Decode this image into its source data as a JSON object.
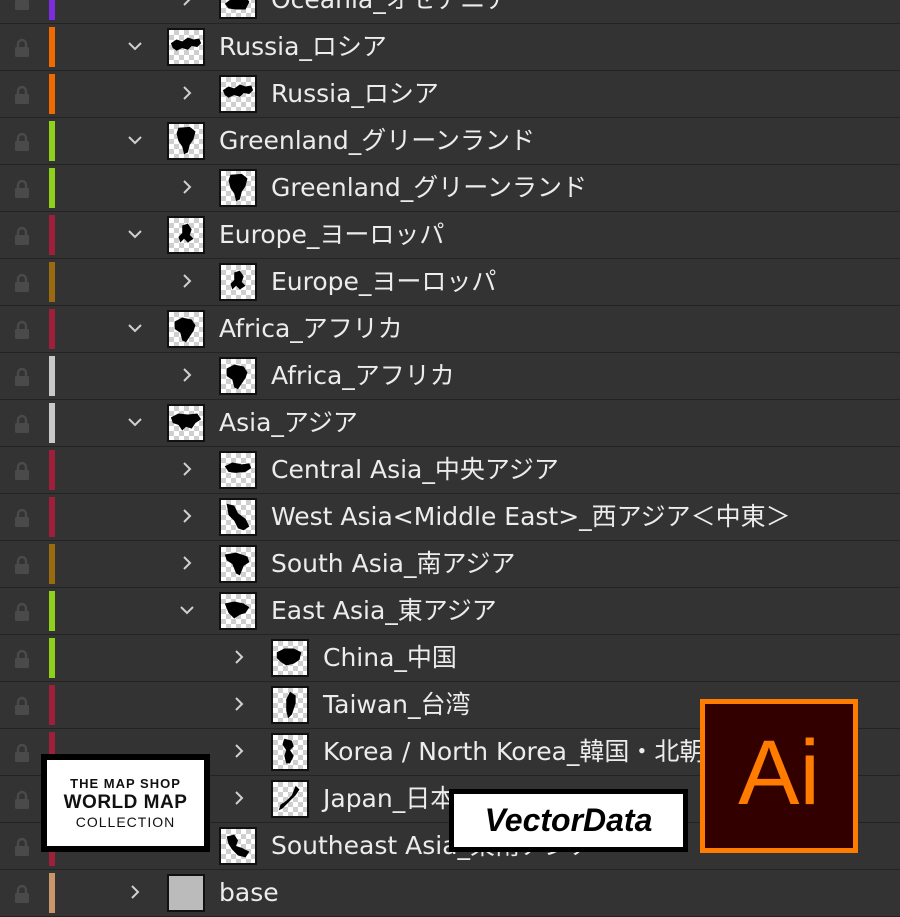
{
  "layers": [
    {
      "label": "Oceania_オセアニア",
      "depth": 1,
      "expanded": false,
      "color": "#7b2cdf",
      "thumb": "oceania"
    },
    {
      "label": "Russia_ロシア",
      "depth": 0,
      "expanded": true,
      "color": "#f06a00",
      "thumb": "russia"
    },
    {
      "label": "Russia_ロシア",
      "depth": 1,
      "expanded": false,
      "color": "#f06a00",
      "thumb": "russia"
    },
    {
      "label": "Greenland_グリーンランド",
      "depth": 0,
      "expanded": true,
      "color": "#8fd11a",
      "thumb": "greenland"
    },
    {
      "label": "Greenland_グリーンランド",
      "depth": 1,
      "expanded": false,
      "color": "#8fd11a",
      "thumb": "greenland"
    },
    {
      "label": "Europe_ヨーロッパ",
      "depth": 0,
      "expanded": true,
      "color": "#9e1f3a",
      "thumb": "europe"
    },
    {
      "label": "Europe_ヨーロッパ",
      "depth": 1,
      "expanded": false,
      "color": "#9a6a10",
      "thumb": "europe"
    },
    {
      "label": "Africa_アフリカ",
      "depth": 0,
      "expanded": true,
      "color": "#9e1f3a",
      "thumb": "africa"
    },
    {
      "label": "Africa_アフリカ",
      "depth": 1,
      "expanded": false,
      "color": "#c8c8c8",
      "thumb": "africa"
    },
    {
      "label": "Asia_アジア",
      "depth": 0,
      "expanded": true,
      "color": "#c8c8c8",
      "thumb": "asia"
    },
    {
      "label": "Central Asia_中央アジア",
      "depth": 1,
      "expanded": false,
      "color": "#9e1f3a",
      "thumb": "central"
    },
    {
      "label": "West Asia<Middle East>_西アジア＜中東＞",
      "depth": 1,
      "expanded": false,
      "color": "#9e1f3a",
      "thumb": "west"
    },
    {
      "label": "South Asia_南アジア",
      "depth": 1,
      "expanded": false,
      "color": "#9a6a10",
      "thumb": "south"
    },
    {
      "label": "East Asia_東アジア",
      "depth": 1,
      "expanded": true,
      "color": "#8fd11a",
      "thumb": "east"
    },
    {
      "label": "China_中国",
      "depth": 2,
      "expanded": false,
      "color": "#8fd11a",
      "thumb": "china"
    },
    {
      "label": "Taiwan_台湾",
      "depth": 2,
      "expanded": false,
      "color": "#9e1f3a",
      "thumb": "taiwan"
    },
    {
      "label": "Korea / North Korea_韓国・北朝鮮",
      "depth": 2,
      "expanded": false,
      "color": "#9e1f3a",
      "thumb": "korea"
    },
    {
      "label": "Japan_日本",
      "depth": 2,
      "expanded": false,
      "color": "#9e1f3a",
      "thumb": "japan"
    },
    {
      "label": "Southeast Asia_東南アジア",
      "depth": 1,
      "expanded": false,
      "color": "#9e1f3a",
      "thumb": "southeast"
    },
    {
      "label": "base",
      "depth": 0,
      "expanded": false,
      "color": "#c9956a",
      "thumb": "base"
    }
  ],
  "badge": {
    "line1": "THE MAP SHOP",
    "line2": "WORLD MAP",
    "line3": "COLLECTION"
  },
  "vector_label": "VectorData",
  "ai_logo": "Ai"
}
